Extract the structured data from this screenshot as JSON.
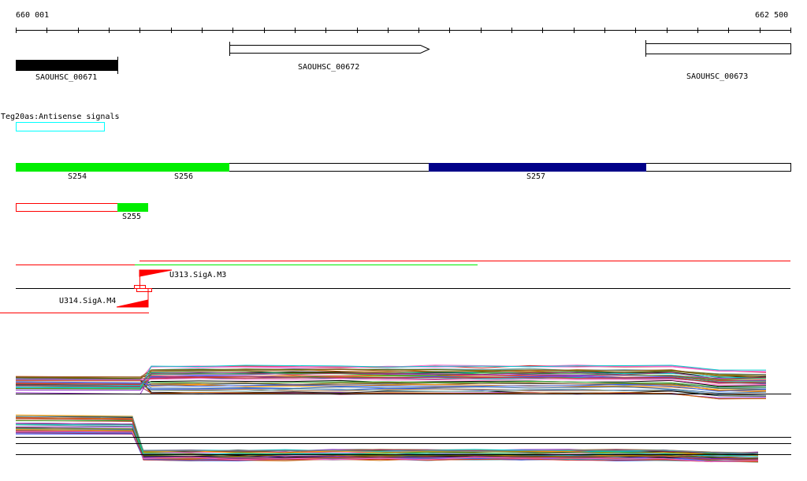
{
  "ruler": {
    "start_label": "660 001",
    "end_label": "662 500"
  },
  "genes": [
    {
      "name": "SAOUHSC_00671",
      "strand": "-"
    },
    {
      "name": "SAOUHSC_00672",
      "strand": "+"
    },
    {
      "name": "SAOUHSC_00673",
      "strand": "+"
    }
  ],
  "track_title": "Teg20as:Antisense signals",
  "segments": [
    {
      "label": "S254",
      "color": "#00ee00"
    },
    {
      "label": "S256",
      "color": "#00ee00"
    },
    {
      "label": "S257",
      "color": "#000088"
    },
    {
      "label": "S255",
      "color": "#00ee00"
    }
  ],
  "promoters": [
    {
      "label": "U313.SigA.M3",
      "color": "#ff0000"
    },
    {
      "label": "U314.SigA.M4",
      "color": "#ff0000"
    }
  ]
}
